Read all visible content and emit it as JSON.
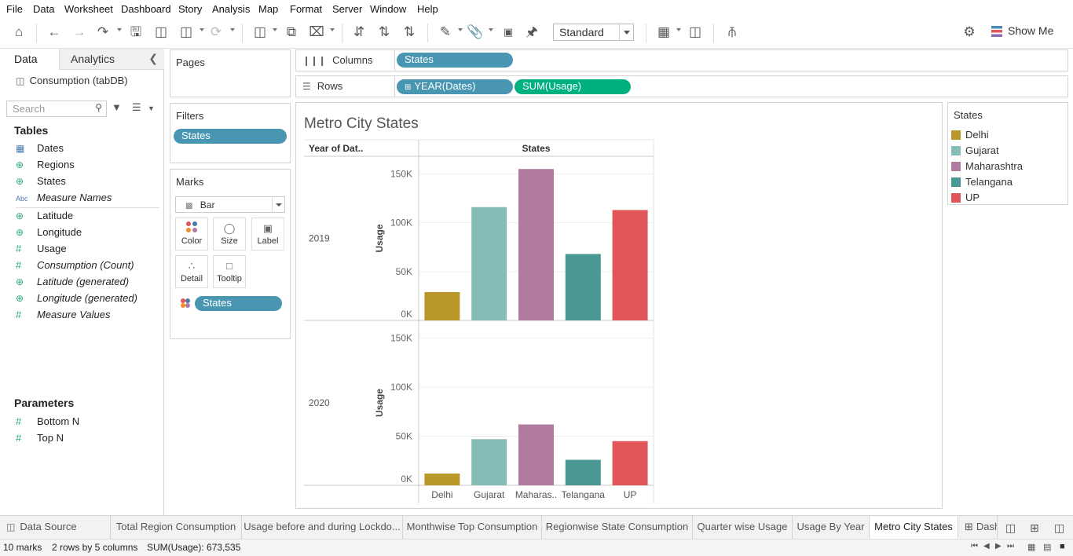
{
  "menu": [
    "File",
    "Data",
    "Worksheet",
    "Dashboard",
    "Story",
    "Analysis",
    "Map",
    "Format",
    "Server",
    "Window",
    "Help"
  ],
  "toolbar": {
    "fit_mode": "Standard",
    "show_me_label": "Show Me",
    "icons": [
      "home-icon",
      "undo-icon",
      "redo-icon",
      "swap-icon",
      "save-icon",
      "new-datasource-icon",
      "pause-updates-icon",
      "refresh-icon",
      "new-worksheet-icon",
      "duplicate-icon",
      "clear-sheet-icon",
      "swap-rows-cols-icon",
      "sort-ascending-icon",
      "sort-descending-icon",
      "highlight-icon",
      "group-icon",
      "show-labels-icon",
      "pin-icon",
      "fit-icon",
      "presentation-icon",
      "share-icon",
      "format-painter-icon"
    ]
  },
  "data_pane": {
    "tab_data": "Data",
    "tab_analytics": "Analytics",
    "datasource": "Consumption (tabDB)",
    "search_placeholder": "Search",
    "tables_heading": "Tables",
    "fields": [
      {
        "label": "Dates",
        "type": "date",
        "italic": false
      },
      {
        "label": "Regions",
        "type": "geo",
        "italic": false
      },
      {
        "label": "States",
        "type": "geo",
        "italic": false
      },
      {
        "label": "Measure Names",
        "type": "abc",
        "italic": true
      },
      {
        "label": "Latitude",
        "type": "geo",
        "italic": false
      },
      {
        "label": "Longitude",
        "type": "geo",
        "italic": false
      },
      {
        "label": "Usage",
        "type": "measure",
        "italic": false
      },
      {
        "label": "Consumption (Count)",
        "type": "measure",
        "italic": true
      },
      {
        "label": "Latitude (generated)",
        "type": "geo",
        "italic": true
      },
      {
        "label": "Longitude (generated)",
        "type": "geo",
        "italic": true
      },
      {
        "label": "Measure Values",
        "type": "measure",
        "italic": true
      }
    ],
    "parameters_heading": "Parameters",
    "parameters": [
      "Bottom N",
      "Top N"
    ]
  },
  "shelves": {
    "pages_title": "Pages",
    "filters_title": "Filters",
    "filter_pill": "States",
    "marks_title": "Marks",
    "marks_type": "Bar",
    "mark_buttons": [
      "Color",
      "Size",
      "Label",
      "Detail",
      "Tooltip"
    ],
    "marks_pill": "States",
    "columns_label": "Columns",
    "columns_pill": "States",
    "rows_label": "Rows",
    "rows_pills": [
      "YEAR(Dates)",
      "SUM(Usage)"
    ]
  },
  "view": {
    "title": "Metro City States"
  },
  "chart_data": {
    "type": "bar",
    "column_header": "States",
    "row_header": "Year of Dat..",
    "ylabel": "Usage",
    "ylim": [
      0,
      160000
    ],
    "yticks": [
      "0K",
      "50K",
      "100K",
      "150K"
    ],
    "categories": [
      "Delhi",
      "Gujarat",
      "Maharashtra",
      "Telangana",
      "UP"
    ],
    "category_labels": [
      "Delhi",
      "Gujarat",
      "Maharas..",
      "Telangana",
      "UP"
    ],
    "colors": [
      "#b8982b",
      "#86bcb6",
      "#b07aa1",
      "#499894",
      "#e15759"
    ],
    "series": [
      {
        "name": "2019",
        "values": [
          29000,
          116000,
          155000,
          68000,
          113000
        ]
      },
      {
        "name": "2020",
        "values": [
          12000,
          47000,
          62000,
          26000,
          45000
        ]
      }
    ]
  },
  "legend": {
    "title": "States",
    "items": [
      {
        "label": "Delhi",
        "color": "#b8982b"
      },
      {
        "label": "Gujarat",
        "color": "#86bcb6"
      },
      {
        "label": "Maharashtra",
        "color": "#b07aa1"
      },
      {
        "label": "Telangana",
        "color": "#499894"
      },
      {
        "label": "UP",
        "color": "#e15759"
      }
    ]
  },
  "sheet_tabs": {
    "data_source": "Data Source",
    "tabs": [
      "Total Region Consumption",
      "Usage before and during Lockdo...",
      "Monthwise Top Consumption",
      "Regionwise State Consumption",
      "Quarter wise Usage",
      "Usage By Year",
      "Metro City States",
      "Dash"
    ],
    "active": "Metro City States"
  },
  "status": {
    "marks": "10 marks",
    "dims": "2 rows by 5 columns",
    "sum": "SUM(Usage): 673,535"
  }
}
